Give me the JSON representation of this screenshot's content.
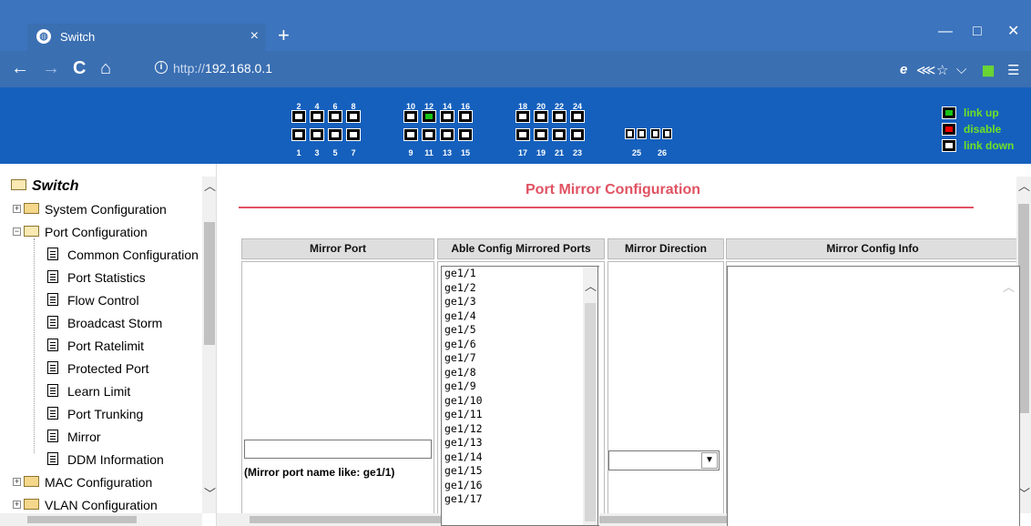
{
  "browser": {
    "tab_title": "Switch",
    "tab_close": "×",
    "new_tab": "+",
    "url_scheme": "http://",
    "url_host": "192.168.0.1",
    "win_min": "—",
    "win_max": "□",
    "win_close": "✕",
    "menu": "☰",
    "star": "☆",
    "chevron": "⌵",
    "nav_back": "←",
    "nav_forward": "→",
    "nav_reload": "C",
    "nav_home": "⌂",
    "ie_icon": "e",
    "share_icon": "⋘"
  },
  "ports": {
    "top_groups": [
      [
        "2",
        "4",
        "6",
        "8"
      ],
      [
        "10",
        "12",
        "14",
        "16"
      ],
      [
        "18",
        "20",
        "22",
        "24"
      ]
    ],
    "bottom_groups": [
      [
        "1",
        "3",
        "5",
        "7"
      ],
      [
        "9",
        "11",
        "13",
        "15"
      ],
      [
        "17",
        "19",
        "21",
        "23"
      ]
    ],
    "sfp_labels": [
      "25",
      "26"
    ],
    "link_up_port": "12",
    "legend": [
      {
        "label": "link up",
        "state": "up"
      },
      {
        "label": "disable",
        "state": "red"
      },
      {
        "label": "link down",
        "state": "down"
      }
    ]
  },
  "sidebar": {
    "root": "Switch",
    "items": [
      {
        "label": "System Configuration",
        "type": "folder",
        "expander": "+"
      },
      {
        "label": "Port Configuration",
        "type": "folder-open",
        "expander": "−"
      },
      {
        "label": "Common Configuration",
        "type": "page"
      },
      {
        "label": "Port Statistics",
        "type": "page"
      },
      {
        "label": "Flow Control",
        "type": "page"
      },
      {
        "label": "Broadcast Storm",
        "type": "page"
      },
      {
        "label": "Port Ratelimit",
        "type": "page"
      },
      {
        "label": "Protected Port",
        "type": "page"
      },
      {
        "label": "Learn Limit",
        "type": "page"
      },
      {
        "label": "Port Trunking",
        "type": "page"
      },
      {
        "label": "Mirror",
        "type": "page"
      },
      {
        "label": "DDM Information",
        "type": "page"
      },
      {
        "label": "MAC Configuration",
        "type": "folder",
        "expander": "+"
      },
      {
        "label": "VLAN Configuration",
        "type": "folder",
        "expander": "+"
      }
    ]
  },
  "main": {
    "title": "Port Mirror Configuration",
    "columns": {
      "mirror_port": "Mirror Port",
      "able_ports": "Able Config Mirrored Ports",
      "direction": "Mirror Direction",
      "info": "Mirror Config Info"
    },
    "mirror_port_value": "",
    "mirror_note": "(Mirror port name like: ge1/1)",
    "ports_list": [
      "ge1/1",
      "ge1/2",
      "ge1/3",
      "ge1/4",
      "ge1/5",
      "ge1/6",
      "ge1/7",
      "ge1/8",
      "ge1/9",
      "ge1/10",
      "ge1/11",
      "ge1/12",
      "ge1/13",
      "ge1/14",
      "ge1/15",
      "ge1/16",
      "ge1/17"
    ],
    "direction_value": "",
    "info_text": ""
  },
  "colors": {
    "tabbar": "#3c74bd",
    "banner": "#1560bd",
    "title_accent": "#e05262",
    "legend_text": "#6fe025"
  }
}
